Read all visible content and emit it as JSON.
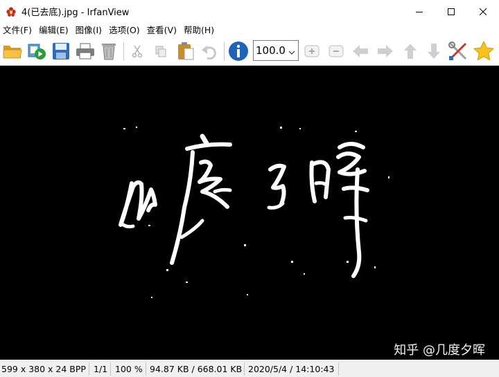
{
  "window": {
    "title": "4(已去底).jpg - IrfanView",
    "minimize_icon": "minimize-icon",
    "maximize_icon": "maximize-icon",
    "close_icon": "close-icon"
  },
  "menu": [
    {
      "label": "文件(F)"
    },
    {
      "label": "编辑(E)"
    },
    {
      "label": "图像(I)"
    },
    {
      "label": "选项(O)"
    },
    {
      "label": "查看(V)"
    },
    {
      "label": "帮助(H)"
    }
  ],
  "toolbar": {
    "icons": [
      "open-folder-icon",
      "slideshow-icon",
      "save-icon",
      "print-icon",
      "delete-icon",
      "cut-icon",
      "copy-icon",
      "paste-icon",
      "undo-icon",
      "info-icon",
      "zoom-in-icon",
      "zoom-out-icon",
      "previous-icon",
      "next-icon",
      "first-icon",
      "last-icon",
      "settings-icon",
      "favorite-star-icon"
    ],
    "zoom_value": "100.0"
  },
  "canvas": {
    "background": "#000000",
    "watermark": "知乎 @几度夕晖"
  },
  "status": {
    "dimensions": "599 x 380 x 24 BPP",
    "page": "1/1",
    "zoom": "100 %",
    "size": "94.87 KB / 668.01 KB",
    "datetime": "2020/5/4 / 14:10:43"
  }
}
